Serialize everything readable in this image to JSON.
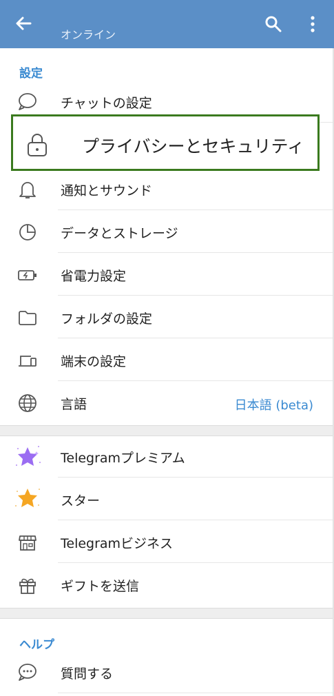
{
  "appbar": {
    "status": "オンライン",
    "back_icon": "arrow-left-icon",
    "search_icon": "search-icon",
    "more_icon": "more-vert-icon"
  },
  "settings": {
    "section_title": "設定",
    "items": [
      {
        "label": "チャットの設定",
        "icon": "chat-bubble-icon"
      },
      {
        "label": "プライバシーとセキュリティ",
        "icon": "lock-icon"
      },
      {
        "label": "通知とサウンド",
        "icon": "bell-icon"
      },
      {
        "label": "データとストレージ",
        "icon": "pie-chart-icon"
      },
      {
        "label": "省電力設定",
        "icon": "battery-icon"
      },
      {
        "label": "フォルダの設定",
        "icon": "folder-icon"
      },
      {
        "label": "端末の設定",
        "icon": "devices-icon"
      },
      {
        "label": "言語",
        "icon": "globe-icon",
        "value": "日本語 (beta)"
      }
    ]
  },
  "premium": {
    "items": [
      {
        "label": "Telegramプレミアム",
        "icon": "premium-star-icon"
      },
      {
        "label": "スター",
        "icon": "star-icon"
      },
      {
        "label": "Telegramビジネス",
        "icon": "shop-icon"
      },
      {
        "label": "ギフトを送信",
        "icon": "gift-icon"
      }
    ]
  },
  "help": {
    "section_title": "ヘルプ",
    "items": [
      {
        "label": "質問する",
        "icon": "question-chat-icon"
      }
    ]
  },
  "colors": {
    "appbar": "#5b8fc7",
    "accent": "#3a8ad1",
    "highlight_border": "#3a7a1e"
  }
}
